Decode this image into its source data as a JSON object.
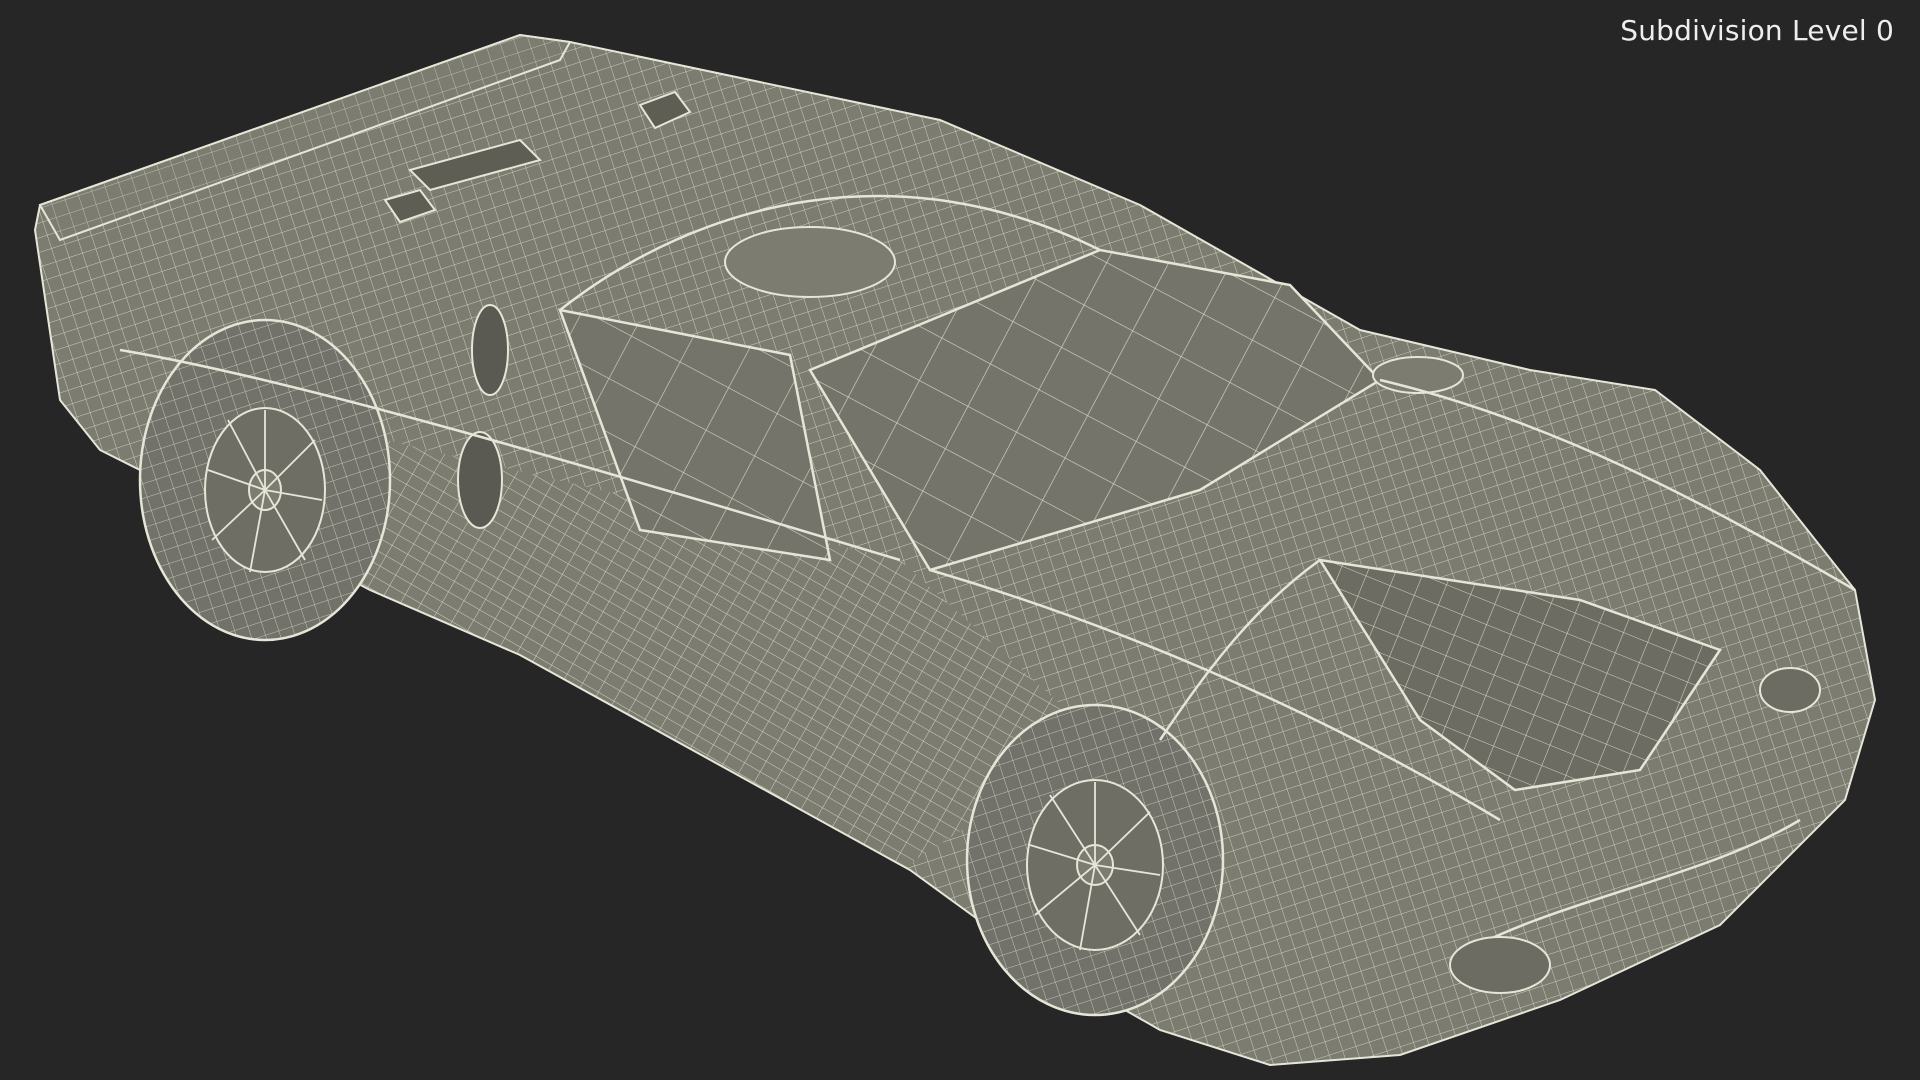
{
  "overlay": {
    "label": "Subdivision Level 0"
  },
  "colors": {
    "background": "#262626",
    "surface": "#7c7c70",
    "wire": "#e6e6d8",
    "label": "#eeeeee"
  }
}
